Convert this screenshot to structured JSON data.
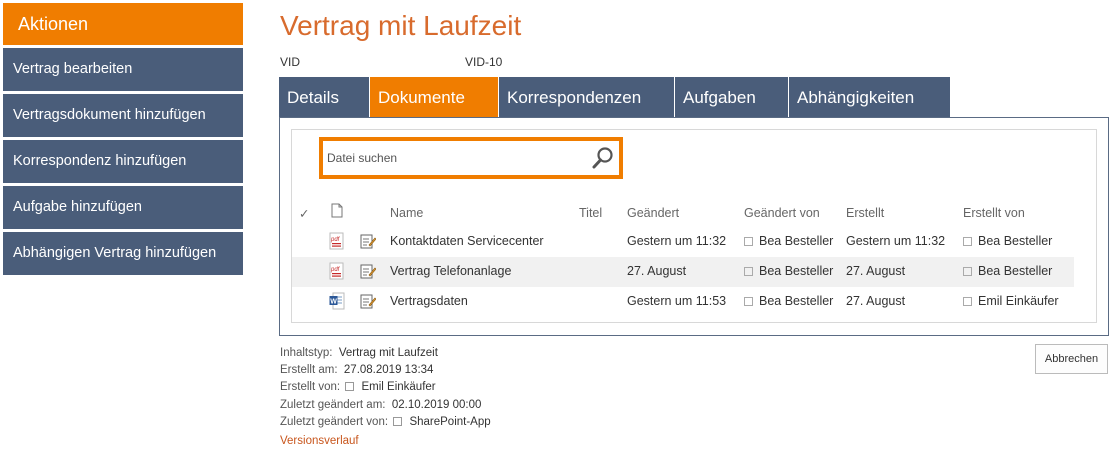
{
  "sidebar": {
    "header": "Aktionen",
    "items": [
      {
        "label": "Vertrag bearbeiten"
      },
      {
        "label": "Vertragsdokument hinzufügen"
      },
      {
        "label": "Korrespondenz hinzufügen"
      },
      {
        "label": "Aufgabe hinzufügen"
      },
      {
        "label": "Abhängigen Vertrag hinzufügen"
      }
    ]
  },
  "page": {
    "title": "Vertrag mit Laufzeit",
    "vid_label": "VID",
    "vid_value": "VID-10"
  },
  "tabs": [
    {
      "label": "Details",
      "active": false
    },
    {
      "label": "Dokumente",
      "active": true
    },
    {
      "label": "Korrespondenzen",
      "active": false
    },
    {
      "label": "Aufgaben",
      "active": false
    },
    {
      "label": "Abhängigkeiten",
      "active": false
    }
  ],
  "search": {
    "placeholder": "Datei suchen",
    "value": ""
  },
  "table": {
    "columns": {
      "check": "✓",
      "name": "Name",
      "title": "Titel",
      "modified": "Geändert",
      "modified_by": "Geändert von",
      "created": "Erstellt",
      "created_by": "Erstellt von"
    },
    "rows": [
      {
        "type": "pdf",
        "name": "Kontaktdaten Servicecenter",
        "title": "",
        "modified": "Gestern um 11:32",
        "modified_by": "Bea Besteller",
        "created": "Gestern um 11:32",
        "created_by": "Bea Besteller"
      },
      {
        "type": "pdf",
        "name": "Vertrag Telefonanlage",
        "title": "",
        "modified": "27. August",
        "modified_by": "Bea Besteller",
        "created": "27. August",
        "created_by": "Bea Besteller"
      },
      {
        "type": "word",
        "name": "Vertragsdaten",
        "title": "",
        "modified": "Gestern um 11:53",
        "modified_by": "Bea Besteller",
        "created": "27. August",
        "created_by": "Emil Einkäufer"
      }
    ]
  },
  "meta": {
    "content_type_label": "Inhaltstyp:",
    "content_type_value": "Vertrag mit Laufzeit",
    "created_at_label": "Erstellt am:",
    "created_at_value": "27.08.2019 13:34",
    "created_by_label": "Erstellt von:",
    "created_by_value": "Emil Einkäufer",
    "modified_at_label": "Zuletzt geändert am:",
    "modified_at_value": "02.10.2019 00:00",
    "modified_by_label": "Zuletzt geändert von:",
    "modified_by_value": "SharePoint-App",
    "versions_link": "Versionsverlauf"
  },
  "buttons": {
    "cancel": "Abbrechen"
  },
  "colors": {
    "accent": "#f07d00",
    "nav": "#4a5d7a",
    "title": "#d86b2d",
    "link": "#c8561d"
  },
  "icons": {
    "search": "magnifier-icon",
    "pdf": "pdf-file-icon",
    "word": "word-file-icon",
    "edit": "edit-properties-icon",
    "doc": "document-header-icon"
  }
}
